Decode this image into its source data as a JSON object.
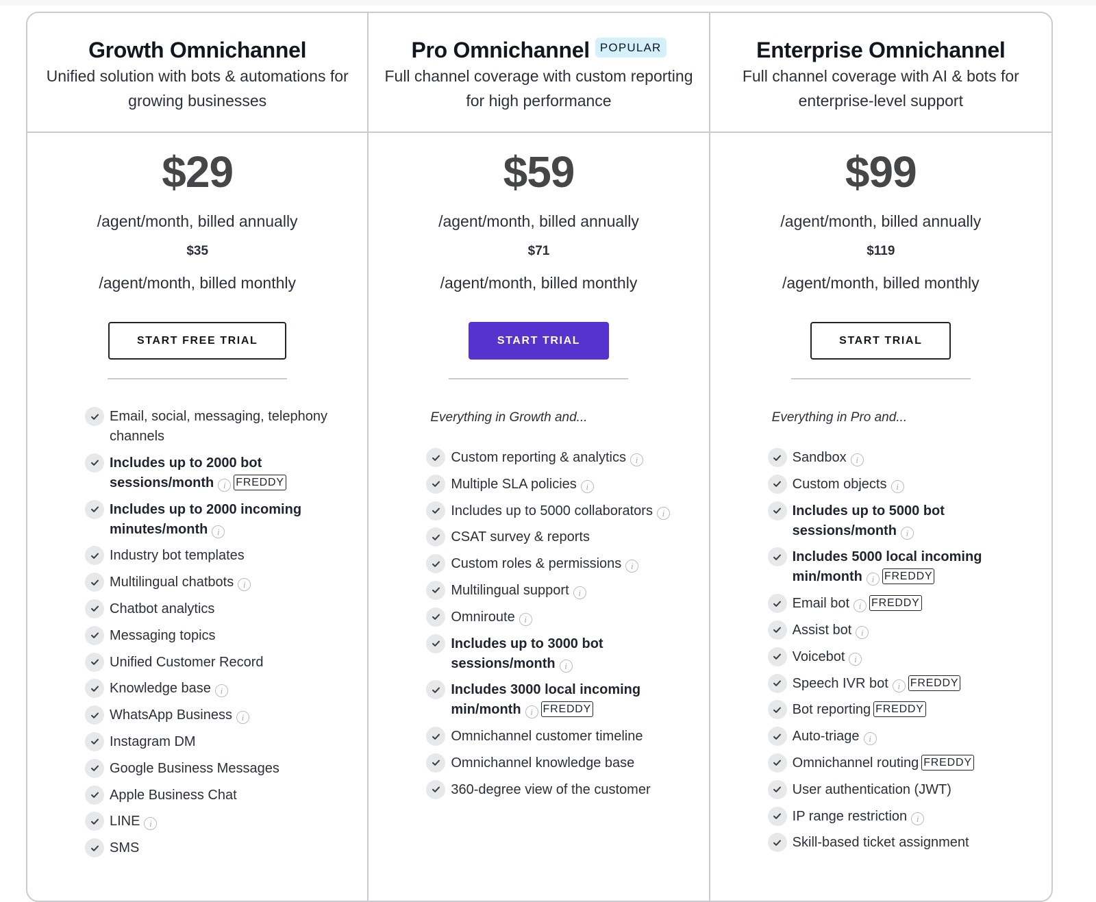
{
  "plans": [
    {
      "title": "Growth Omnichannel",
      "badge": null,
      "description": "Unified solution with bots & automations for growing businesses",
      "price_annual": "$29",
      "billed_annual_label": "/agent/month, billed annually",
      "price_monthly": "$35",
      "billed_monthly_label": "/agent/month, billed monthly",
      "cta_label": "START FREE TRIAL",
      "cta_style": "outline",
      "intro": null,
      "features": [
        {
          "text": "Email, social, messaging, telephony channels",
          "bold": false,
          "info": false,
          "freddy": false
        },
        {
          "text": "Includes up to 2000 bot sessions/month",
          "bold": true,
          "info": true,
          "freddy": true
        },
        {
          "text": "Includes up to 2000 incoming minutes/month",
          "bold": true,
          "info": true,
          "freddy": false
        },
        {
          "text": "Industry bot templates",
          "bold": false,
          "info": false,
          "freddy": false
        },
        {
          "text": "Multilingual chatbots",
          "bold": false,
          "info": true,
          "freddy": false
        },
        {
          "text": "Chatbot analytics",
          "bold": false,
          "info": false,
          "freddy": false
        },
        {
          "text": "Messaging topics",
          "bold": false,
          "info": false,
          "freddy": false
        },
        {
          "text": "Unified Customer Record",
          "bold": false,
          "info": false,
          "freddy": false
        },
        {
          "text": "Knowledge base",
          "bold": false,
          "info": true,
          "freddy": false
        },
        {
          "text": "WhatsApp Business",
          "bold": false,
          "info": true,
          "freddy": false
        },
        {
          "text": "Instagram DM",
          "bold": false,
          "info": false,
          "freddy": false
        },
        {
          "text": "Google Business Messages",
          "bold": false,
          "info": false,
          "freddy": false
        },
        {
          "text": "Apple Business Chat",
          "bold": false,
          "info": false,
          "freddy": false
        },
        {
          "text": "LINE",
          "bold": false,
          "info": true,
          "freddy": false
        },
        {
          "text": "SMS",
          "bold": false,
          "info": false,
          "freddy": false
        }
      ]
    },
    {
      "title": "Pro Omnichannel",
      "badge": "POPULAR",
      "description": "Full channel coverage with custom reporting for high performance",
      "price_annual": "$59",
      "billed_annual_label": "/agent/month, billed annually",
      "price_monthly": "$71",
      "billed_monthly_label": "/agent/month, billed monthly",
      "cta_label": "START TRIAL",
      "cta_style": "primary",
      "intro": "Everything in Growth and...",
      "features": [
        {
          "text": "Custom reporting & analytics",
          "bold": false,
          "info": true,
          "freddy": false
        },
        {
          "text": "Multiple SLA policies",
          "bold": false,
          "info": true,
          "freddy": false
        },
        {
          "text": "Includes up to 5000 collaborators",
          "bold": false,
          "info": true,
          "freddy": false
        },
        {
          "text": "CSAT survey & reports",
          "bold": false,
          "info": false,
          "freddy": false
        },
        {
          "text": "Custom roles & permissions",
          "bold": false,
          "info": true,
          "freddy": false
        },
        {
          "text": "Multilingual support",
          "bold": false,
          "info": true,
          "freddy": false
        },
        {
          "text": "Omniroute",
          "bold": false,
          "info": true,
          "freddy": false
        },
        {
          "text": "Includes up to 3000 bot sessions/month",
          "bold": true,
          "info": true,
          "freddy": false
        },
        {
          "text": "Includes 3000 local incoming min/month",
          "bold": true,
          "info": true,
          "freddy": true
        },
        {
          "text": "Omnichannel customer timeline",
          "bold": false,
          "info": false,
          "freddy": false
        },
        {
          "text": "Omnichannel knowledge base",
          "bold": false,
          "info": false,
          "freddy": false
        },
        {
          "text": "360-degree view of the customer",
          "bold": false,
          "info": false,
          "freddy": false
        }
      ]
    },
    {
      "title": "Enterprise Omnichannel",
      "badge": null,
      "description": "Full channel coverage with AI & bots for enterprise-level support",
      "price_annual": "$99",
      "billed_annual_label": "/agent/month, billed annually",
      "price_monthly": "$119",
      "billed_monthly_label": "/agent/month, billed monthly",
      "cta_label": "START TRIAL",
      "cta_style": "outline",
      "intro": "Everything in Pro and...",
      "features": [
        {
          "text": "Sandbox",
          "bold": false,
          "info": true,
          "freddy": false
        },
        {
          "text": "Custom objects",
          "bold": false,
          "info": true,
          "freddy": false
        },
        {
          "text": "Includes up to 5000 bot sessions/month",
          "bold": true,
          "info": true,
          "freddy": false
        },
        {
          "text": "Includes 5000 local incoming min/month",
          "bold": true,
          "info": true,
          "freddy": true
        },
        {
          "text": "Email bot",
          "bold": false,
          "info": true,
          "freddy": true
        },
        {
          "text": "Assist bot",
          "bold": false,
          "info": true,
          "freddy": false
        },
        {
          "text": "Voicebot",
          "bold": false,
          "info": true,
          "freddy": false
        },
        {
          "text": "Speech IVR bot",
          "bold": false,
          "info": true,
          "freddy": true
        },
        {
          "text": "Bot reporting",
          "bold": false,
          "info": false,
          "freddy": true
        },
        {
          "text": "Auto-triage",
          "bold": false,
          "info": true,
          "freddy": false
        },
        {
          "text": "Omnichannel routing",
          "bold": false,
          "info": false,
          "freddy": true
        },
        {
          "text": "User authentication (JWT)",
          "bold": false,
          "info": false,
          "freddy": false
        },
        {
          "text": "IP range restriction",
          "bold": false,
          "info": true,
          "freddy": false
        },
        {
          "text": "Skill-based ticket assignment",
          "bold": false,
          "info": false,
          "freddy": false
        }
      ]
    }
  ],
  "labels": {
    "info_glyph": "i",
    "freddy_tag": "FREDDY"
  },
  "icons": {
    "check": "check-icon",
    "info": "info-icon"
  },
  "colors": {
    "primary_button": "#5533cc",
    "popular_badge_bg": "#d4f0fb",
    "price_text": "#454648",
    "border": "#c9cbcf"
  }
}
